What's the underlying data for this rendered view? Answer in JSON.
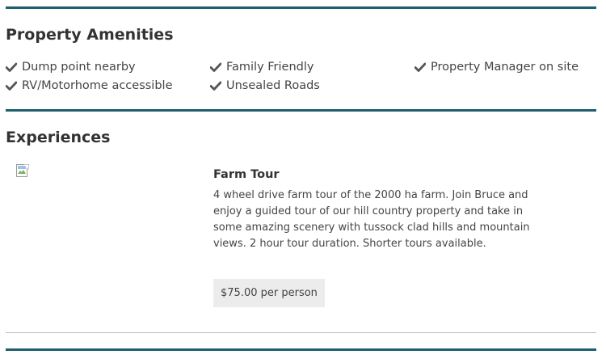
{
  "amenities": {
    "title": "Property Amenities",
    "items": [
      {
        "label": "Dump point nearby",
        "icon": "check-icon"
      },
      {
        "label": "Family Friendly",
        "icon": "check-icon"
      },
      {
        "label": "Property Manager on site",
        "icon": "check-icon"
      },
      {
        "label": "RV/Motorhome accessible",
        "icon": "check-icon"
      },
      {
        "label": "Unsealed Roads",
        "icon": "check-icon"
      }
    ]
  },
  "experiences": {
    "title": "Experiences",
    "items": [
      {
        "title": "Farm Tour",
        "image": "broken-image-icon",
        "description": "4 wheel drive farm tour of the 2000 ha farm. Join Bruce and enjoy a guided tour of our hill country property and take in some amazing scenery with tussock clad hills and mountain views. 2 hour tour duration. Shorter tours available.",
        "price": "$75.00 per person"
      }
    ]
  },
  "colors": {
    "accent": "#1d5f6e",
    "text": "#333333",
    "badge_background": "#ececec",
    "divider": "#bdbdbd"
  }
}
